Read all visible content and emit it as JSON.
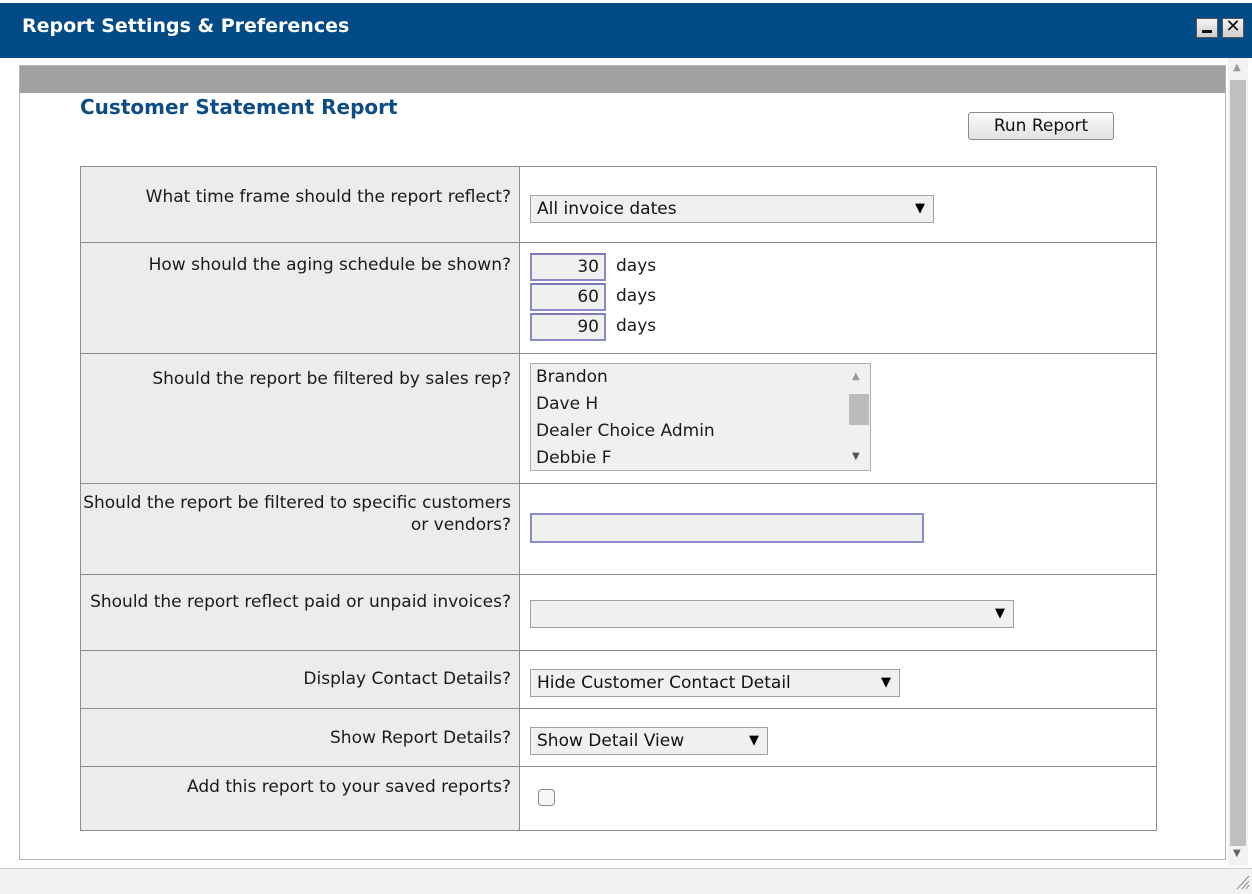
{
  "window": {
    "title": "Report Settings & Preferences",
    "minimize_glyph": "_",
    "close_glyph": "✕"
  },
  "report": {
    "title": "Customer Statement Report",
    "run_button": "Run Report"
  },
  "settings": {
    "time_frame": {
      "question": "What time frame should the report reflect?",
      "value": "All invoice dates"
    },
    "aging": {
      "question": "How should the aging schedule be shown?",
      "buckets": [
        {
          "value": "30",
          "unit": "days"
        },
        {
          "value": "60",
          "unit": "days"
        },
        {
          "value": "90",
          "unit": "days"
        }
      ]
    },
    "sales_rep": {
      "question": "Should the report be filtered by sales rep?",
      "options": [
        "Brandon",
        "Dave H",
        "Dealer Choice Admin",
        "Debbie F"
      ]
    },
    "customers": {
      "question": "Should the report be filtered to specific customers or vendors?",
      "value": ""
    },
    "paid_status": {
      "question": "Should the report reflect paid or unpaid invoices?",
      "value": ""
    },
    "contact_details": {
      "question": "Display Contact Details?",
      "value": "Hide Customer Contact Detail"
    },
    "report_details": {
      "question": "Show Report Details?",
      "value": "Show Detail View"
    },
    "save_report": {
      "question": "Add this report to your saved reports?",
      "checked": false
    }
  },
  "colors": {
    "title_bar": "#024b86",
    "report_title": "#0d4d83",
    "question_cell": "#ececec"
  }
}
